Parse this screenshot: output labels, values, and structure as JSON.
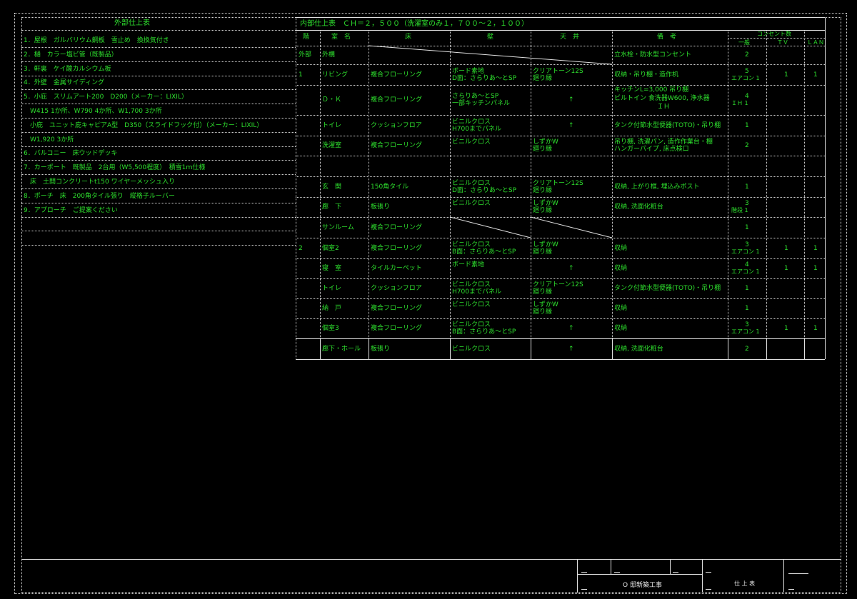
{
  "exterior": {
    "title": "外部仕上表",
    "items": [
      "1．屋根　ガルバリウム鋼板　雪止め　換換気付き",
      "2．樋　カラー塩ビ管（既製品）",
      "3．軒裏　ケイ酸カルシウム板",
      "4．外壁　金属サイディング",
      "5．小庇　スリムアート200　D200（メーカー：LIXIL）",
      "　W415 1か所、W790 4か所、W1,700 3か所",
      "　小庇　ユニット庇キャピアA型　D350（スライドフック付）（メーカー：LIXIL）",
      "　W1,920 3か所",
      "6．バルコニー　床ウッドデッキ",
      "7．カーポート　既製品　2台用（W5,500程度）　積雪1ｍ仕様",
      "　床　土間コンクリートt150 ワイヤーメッシュ入り",
      "8．ポーチ　床　200角タイル張り　縦格子ルーバー",
      "9．アプローチ　ご提案ください"
    ]
  },
  "interior": {
    "title": "内部仕上表　ＣＨ＝２，５００（洗濯室のみ１，７００～２，１００）",
    "headers": {
      "floor": "階",
      "room": "室　名",
      "yuka": "床",
      "kabe": "壁",
      "tenjo": "天　井",
      "biko": "備　考",
      "outlet": "コンセント数",
      "ippan": "一般",
      "tv": "ＴＶ",
      "lan": "ＬＡＮ"
    },
    "rows": [
      {
        "floor": "外部",
        "room": "外構",
        "yuka": "",
        "kabe": "",
        "tenjo": "",
        "biko": "立水栓・防水型コンセント",
        "ippan": "2",
        "ippan2": "",
        "tv": "",
        "lan": ""
      },
      {
        "floor": "1",
        "room": "リビング",
        "yuka": "複合フローリング",
        "kabe": "ボード素地",
        "kabe2": "D面：さらりあ～とSP",
        "tenjo": "クリアトーン12S",
        "tenjo2": "廻り縁",
        "biko": "収納・吊り棚・造作机",
        "ippan": "5",
        "ippan2": "エアコン 1",
        "tv": "1",
        "lan": "1"
      },
      {
        "floor": "",
        "room": "Ｄ・Ｋ",
        "yuka": "複合フローリング",
        "kabe": "さらりあ～とSP",
        "kabe2": "一部キッチンパネル",
        "tenjo": "↑",
        "tenjo2": "",
        "biko": "キッチンL=3,000 吊り棚",
        "biko2": "ビルトイン 食洗器W600, 浄水器",
        "biko3": "ＩＨ",
        "ippan": "4",
        "ippan2": "ＩＨ 1",
        "tv": "",
        "lan": ""
      },
      {
        "floor": "",
        "room": "トイレ",
        "yuka": "クッションフロア",
        "kabe": "ビニルクロス",
        "kabe2": "H700までパネル",
        "tenjo": "↑",
        "tenjo2": "",
        "biko": "タンク付節水型便器(TOTO)・吊り棚",
        "ippan": "1",
        "ippan2": "",
        "tv": "",
        "lan": ""
      },
      {
        "floor": "",
        "room": "洗濯室",
        "yuka": "複合フローリング",
        "kabe": "ビニルクロス",
        "kabe2": "",
        "tenjo": "しずかW",
        "tenjo2": "廻り縁",
        "biko": "吊り棚, 洗濯パン, 造作作業台・棚",
        "biko2": "ハンガーパイプ, 床点検口",
        "ippan": "2",
        "ippan2": "",
        "tv": "",
        "lan": ""
      },
      {
        "floor": "",
        "room": "",
        "yuka": "",
        "kabe": "",
        "kabe2": "",
        "tenjo": "",
        "tenjo2": "",
        "biko": "",
        "ippan": "",
        "ippan2": "",
        "tv": "",
        "lan": ""
      },
      {
        "floor": "",
        "room": "玄　関",
        "yuka": "150角タイル",
        "kabe": "ビニルクロス",
        "kabe2": "D面：さらりあ～とSP",
        "tenjo": "クリアトーン12S",
        "tenjo2": "廻り縁",
        "biko": "収納, 上がり框, 埋込みポスト",
        "ippan": "1",
        "ippan2": "",
        "tv": "",
        "lan": ""
      },
      {
        "floor": "",
        "room": "廊　下",
        "yuka": "板張り",
        "kabe": "ビニルクロス",
        "kabe2": "",
        "tenjo": "しずかW",
        "tenjo2": "廻り縁",
        "biko": "収納, 洗面化粧台",
        "ippan": "3",
        "ippan2": "階段 1",
        "tv": "",
        "lan": ""
      },
      {
        "floor": "",
        "room": "サンルーム",
        "yuka": "複合フローリング",
        "kabe": "",
        "kabe2": "",
        "tenjo": "",
        "tenjo2": "",
        "biko": "",
        "ippan": "1",
        "ippan2": "",
        "tv": "",
        "lan": ""
      },
      {
        "floor": "2",
        "room": "個室2",
        "yuka": "複合フローリング",
        "kabe": "ビニルクロス",
        "kabe2": "B面：さらりあ～とSP",
        "tenjo": "しずかW",
        "tenjo2": "廻り縁",
        "biko": "収納",
        "ippan": "3",
        "ippan2": "エアコン 1",
        "tv": "1",
        "lan": "1"
      },
      {
        "floor": "",
        "room": "寝　室",
        "yuka": "タイルカーペット",
        "kabe": "ボード素地",
        "kabe2": "",
        "tenjo": "↑",
        "tenjo2": "",
        "biko": "収納",
        "ippan": "4",
        "ippan2": "エアコン 1",
        "tv": "1",
        "lan": "1"
      },
      {
        "floor": "",
        "room": "トイレ",
        "yuka": "クッションフロア",
        "kabe": "ビニルクロス",
        "kabe2": "H700までパネル",
        "tenjo": "クリアトーン12S",
        "tenjo2": "廻り縁",
        "biko": "タンク付節水型便器(TOTO)・吊り棚",
        "ippan": "1",
        "ippan2": "",
        "tv": "",
        "lan": ""
      },
      {
        "floor": "",
        "room": "納　戸",
        "yuka": "複合フローリング",
        "kabe": "ビニルクロス",
        "kabe2": "",
        "tenjo": "しずかW",
        "tenjo2": "廻り縁",
        "biko": "収納",
        "ippan": "1",
        "ippan2": "",
        "tv": "",
        "lan": ""
      },
      {
        "floor": "",
        "room": "個室3",
        "yuka": "複合フローリング",
        "kabe": "ビニルクロス",
        "kabe2": "B面：さらりあ～とSP",
        "tenjo": "↑",
        "tenjo2": "",
        "biko": "収納",
        "ippan": "3",
        "ippan2": "エアコン 1",
        "tv": "1",
        "lan": "1"
      },
      {
        "floor": "",
        "room": "廊下・ホール",
        "yuka": "板張り",
        "kabe": "ビニルクロス",
        "kabe2": "",
        "tenjo": "↑",
        "tenjo2": "",
        "biko": "収納, 洗面化粧台",
        "ippan": "2",
        "ippan2": "",
        "tv": "",
        "lan": ""
      }
    ]
  },
  "titleblock": {
    "project": "O 邸新築工事",
    "drawing": "仕 上 表"
  },
  "colors": {
    "background": "#000000",
    "text": "#2ee02e",
    "line": "#e0e0e0"
  }
}
